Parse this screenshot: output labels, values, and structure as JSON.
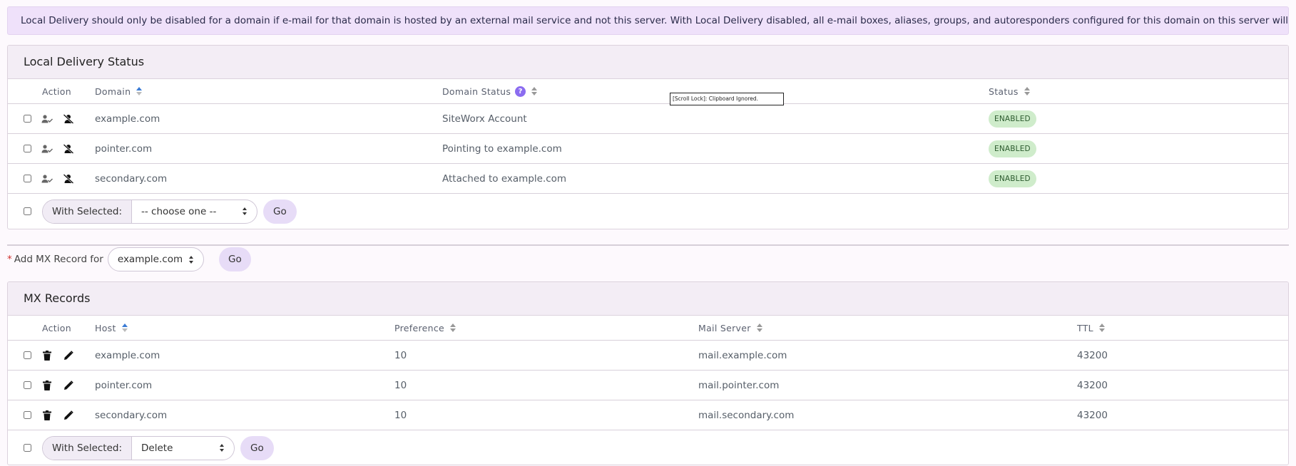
{
  "notice": "Local Delivery should only be disabled for a domain if e-mail for that domain is hosted by an external mail service and not this server. With Local Delivery disabled, all e-mail boxes, aliases, groups, and autoresponders configured for this domain on this server will not be active.",
  "local_delivery": {
    "title": "Local Delivery Status",
    "headers": {
      "action": "Action",
      "domain": "Domain",
      "domain_status": "Domain Status",
      "help": "?",
      "status": "Status"
    },
    "rows": [
      {
        "domain": "example.com",
        "domain_status": "SiteWorx Account",
        "status": "ENABLED"
      },
      {
        "domain": "pointer.com",
        "domain_status": "Pointing to example.com",
        "status": "ENABLED"
      },
      {
        "domain": "secondary.com",
        "domain_status": "Attached to example.com",
        "status": "ENABLED"
      }
    ],
    "footer": {
      "with_selected": "With Selected:",
      "choice": "-- choose one --",
      "go": "Go"
    }
  },
  "tooltip": "[Scroll Lock]:  Clipboard Ignored.",
  "add_mx": {
    "required_mark": "*",
    "label": "Add MX Record for",
    "domain": "example.com",
    "go": "Go"
  },
  "mx_records": {
    "title": "MX Records",
    "headers": {
      "action": "Action",
      "host": "Host",
      "preference": "Preference",
      "mail_server": "Mail Server",
      "ttl": "TTL"
    },
    "rows": [
      {
        "host": "example.com",
        "preference": "10",
        "mail_server": "mail.example.com",
        "ttl": "43200"
      },
      {
        "host": "pointer.com",
        "preference": "10",
        "mail_server": "mail.pointer.com",
        "ttl": "43200"
      },
      {
        "host": "secondary.com",
        "preference": "10",
        "mail_server": "mail.secondary.com",
        "ttl": "43200"
      }
    ],
    "footer": {
      "with_selected": "With Selected:",
      "choice": "Delete",
      "go": "Go"
    }
  },
  "colors": {
    "accent": "#8b6cf0",
    "notice_bg": "#efe1fa",
    "badge_bg": "#cfeccb",
    "go_bg": "#e7dcf7"
  },
  "icons": {
    "enable": "user-check-icon",
    "disable": "user-slash-icon",
    "delete": "trash-icon",
    "edit": "pencil-icon"
  }
}
